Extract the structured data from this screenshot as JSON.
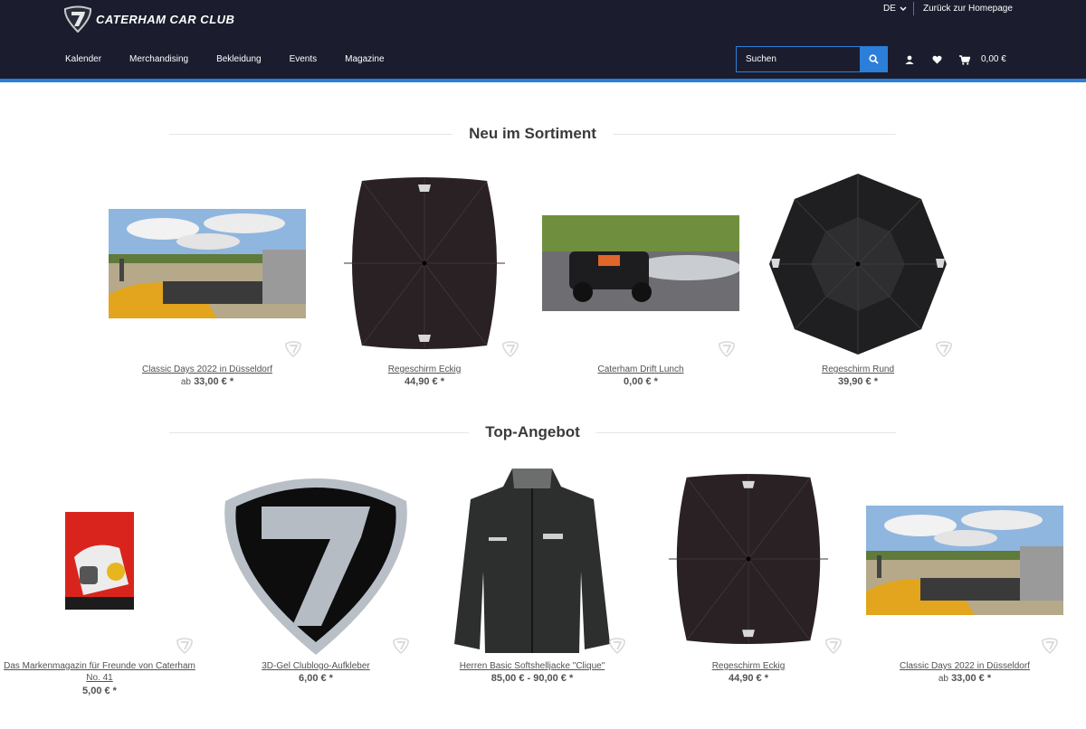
{
  "header": {
    "logo_text": "CATERHAM CAR CLUB",
    "language": "DE",
    "homepage_link": "Zurück zur Homepage",
    "nav": [
      "Kalender",
      "Merchandising",
      "Bekleidung",
      "Events",
      "Magazine"
    ],
    "search_placeholder": "Suchen",
    "cart_total": "0,00 €"
  },
  "colors": {
    "header_bg": "#1b1d2e",
    "accent": "#2b7fd9"
  },
  "sections": {
    "new": {
      "title": "Neu im Sortiment",
      "products": [
        {
          "name": "Classic Days 2022 in Düsseldorf",
          "price_prefix": "ab",
          "price": "33,00 € *"
        },
        {
          "name": "Regeschirm Eckig",
          "price_prefix": "",
          "price": "44,90 € *"
        },
        {
          "name": "Caterham Drift Lunch",
          "price_prefix": "",
          "price": "0,00 € *"
        },
        {
          "name": "Regeschirm Rund",
          "price_prefix": "",
          "price": "39,90 € *"
        }
      ]
    },
    "top": {
      "title": "Top-Angebot",
      "products": [
        {
          "name": "Das Markenmagazin für Freunde von Caterham No. 41",
          "price_prefix": "",
          "price": "5,00 € *"
        },
        {
          "name": "3D-Gel Clublogo-Aufkleber",
          "price_prefix": "",
          "price": "6,00 € *"
        },
        {
          "name": "Herren Basic Softshelljacke \"Clique\"",
          "price_prefix": "",
          "price": "85,00 € - 90,00 € *"
        },
        {
          "name": "Regeschirm Eckig",
          "price_prefix": "",
          "price": "44,90 € *"
        },
        {
          "name": "Classic Days 2022 in Düsseldorf",
          "price_prefix": "ab",
          "price": "33,00 € *"
        }
      ]
    }
  }
}
